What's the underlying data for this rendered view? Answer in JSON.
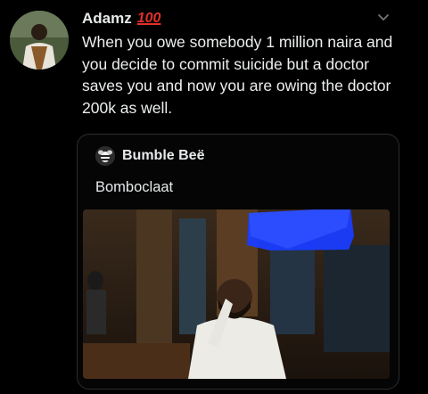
{
  "tweet": {
    "author_name": "Adamz",
    "name_emoji": "100",
    "emoji_icon": "hundred-points-icon",
    "menu_icon": "chevron-down-icon",
    "text": "When you owe somebody 1 million naira and you decide to commit suicide but a doctor saves you and now you are owing the doctor 200k as well."
  },
  "quoted_tweet": {
    "author_name": "Bumble Beë",
    "avatar_icon": "bee-avatar-icon",
    "text": "Bomboclaat",
    "media": "photo"
  },
  "colors": {
    "background": "#000000",
    "text": "#e7e9ea",
    "border": "#2a2d30",
    "emoji_red": "#e0302a",
    "scribble_blue": "#1a3cff"
  }
}
